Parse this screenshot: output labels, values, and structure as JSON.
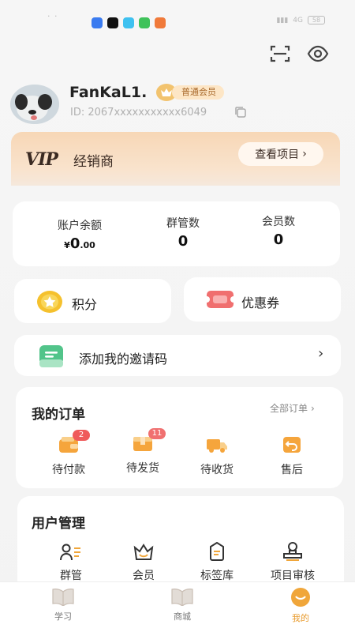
{
  "status_bar": {
    "left_text": "· ·",
    "network": "4G",
    "battery": "58"
  },
  "profile": {
    "username": "FanKaL1.",
    "member_badge": "普通会员",
    "uid": "ID: 2067xxxxxxxxxxx6049"
  },
  "vip": {
    "logo": "VIP",
    "title": "经销商",
    "button": "查看项目"
  },
  "stats": {
    "balance": {
      "label": "账户余额",
      "currency": "¥",
      "integer": "0",
      "decimal": ".00"
    },
    "groups": {
      "label": "群管数",
      "value": "0"
    },
    "members": {
      "label": "会员数",
      "value": "0"
    }
  },
  "points": {
    "label": "积分"
  },
  "coupons": {
    "label": "优惠券"
  },
  "invite": {
    "label": "添加我的邀请码"
  },
  "orders": {
    "title": "我的订单",
    "all_link": "全部订单",
    "items": [
      {
        "label": "待付款",
        "badge": "2"
      },
      {
        "label": "待发货",
        "badge": "11"
      },
      {
        "label": "待收货"
      },
      {
        "label": "售后"
      }
    ]
  },
  "user_mgmt": {
    "title": "用户管理",
    "items": [
      {
        "label": "群管"
      },
      {
        "label": "会员"
      },
      {
        "label": "标签库"
      },
      {
        "label": "项目审核"
      }
    ]
  },
  "tabbar": {
    "items": [
      {
        "label": "学习"
      },
      {
        "label": "商城"
      },
      {
        "label": "我的"
      }
    ],
    "active_color": "#e89a2c"
  },
  "colors": {
    "accent": "#f0a63a",
    "badge_red": "#ef5b5b",
    "vip_bg": "#f7d7b6"
  }
}
